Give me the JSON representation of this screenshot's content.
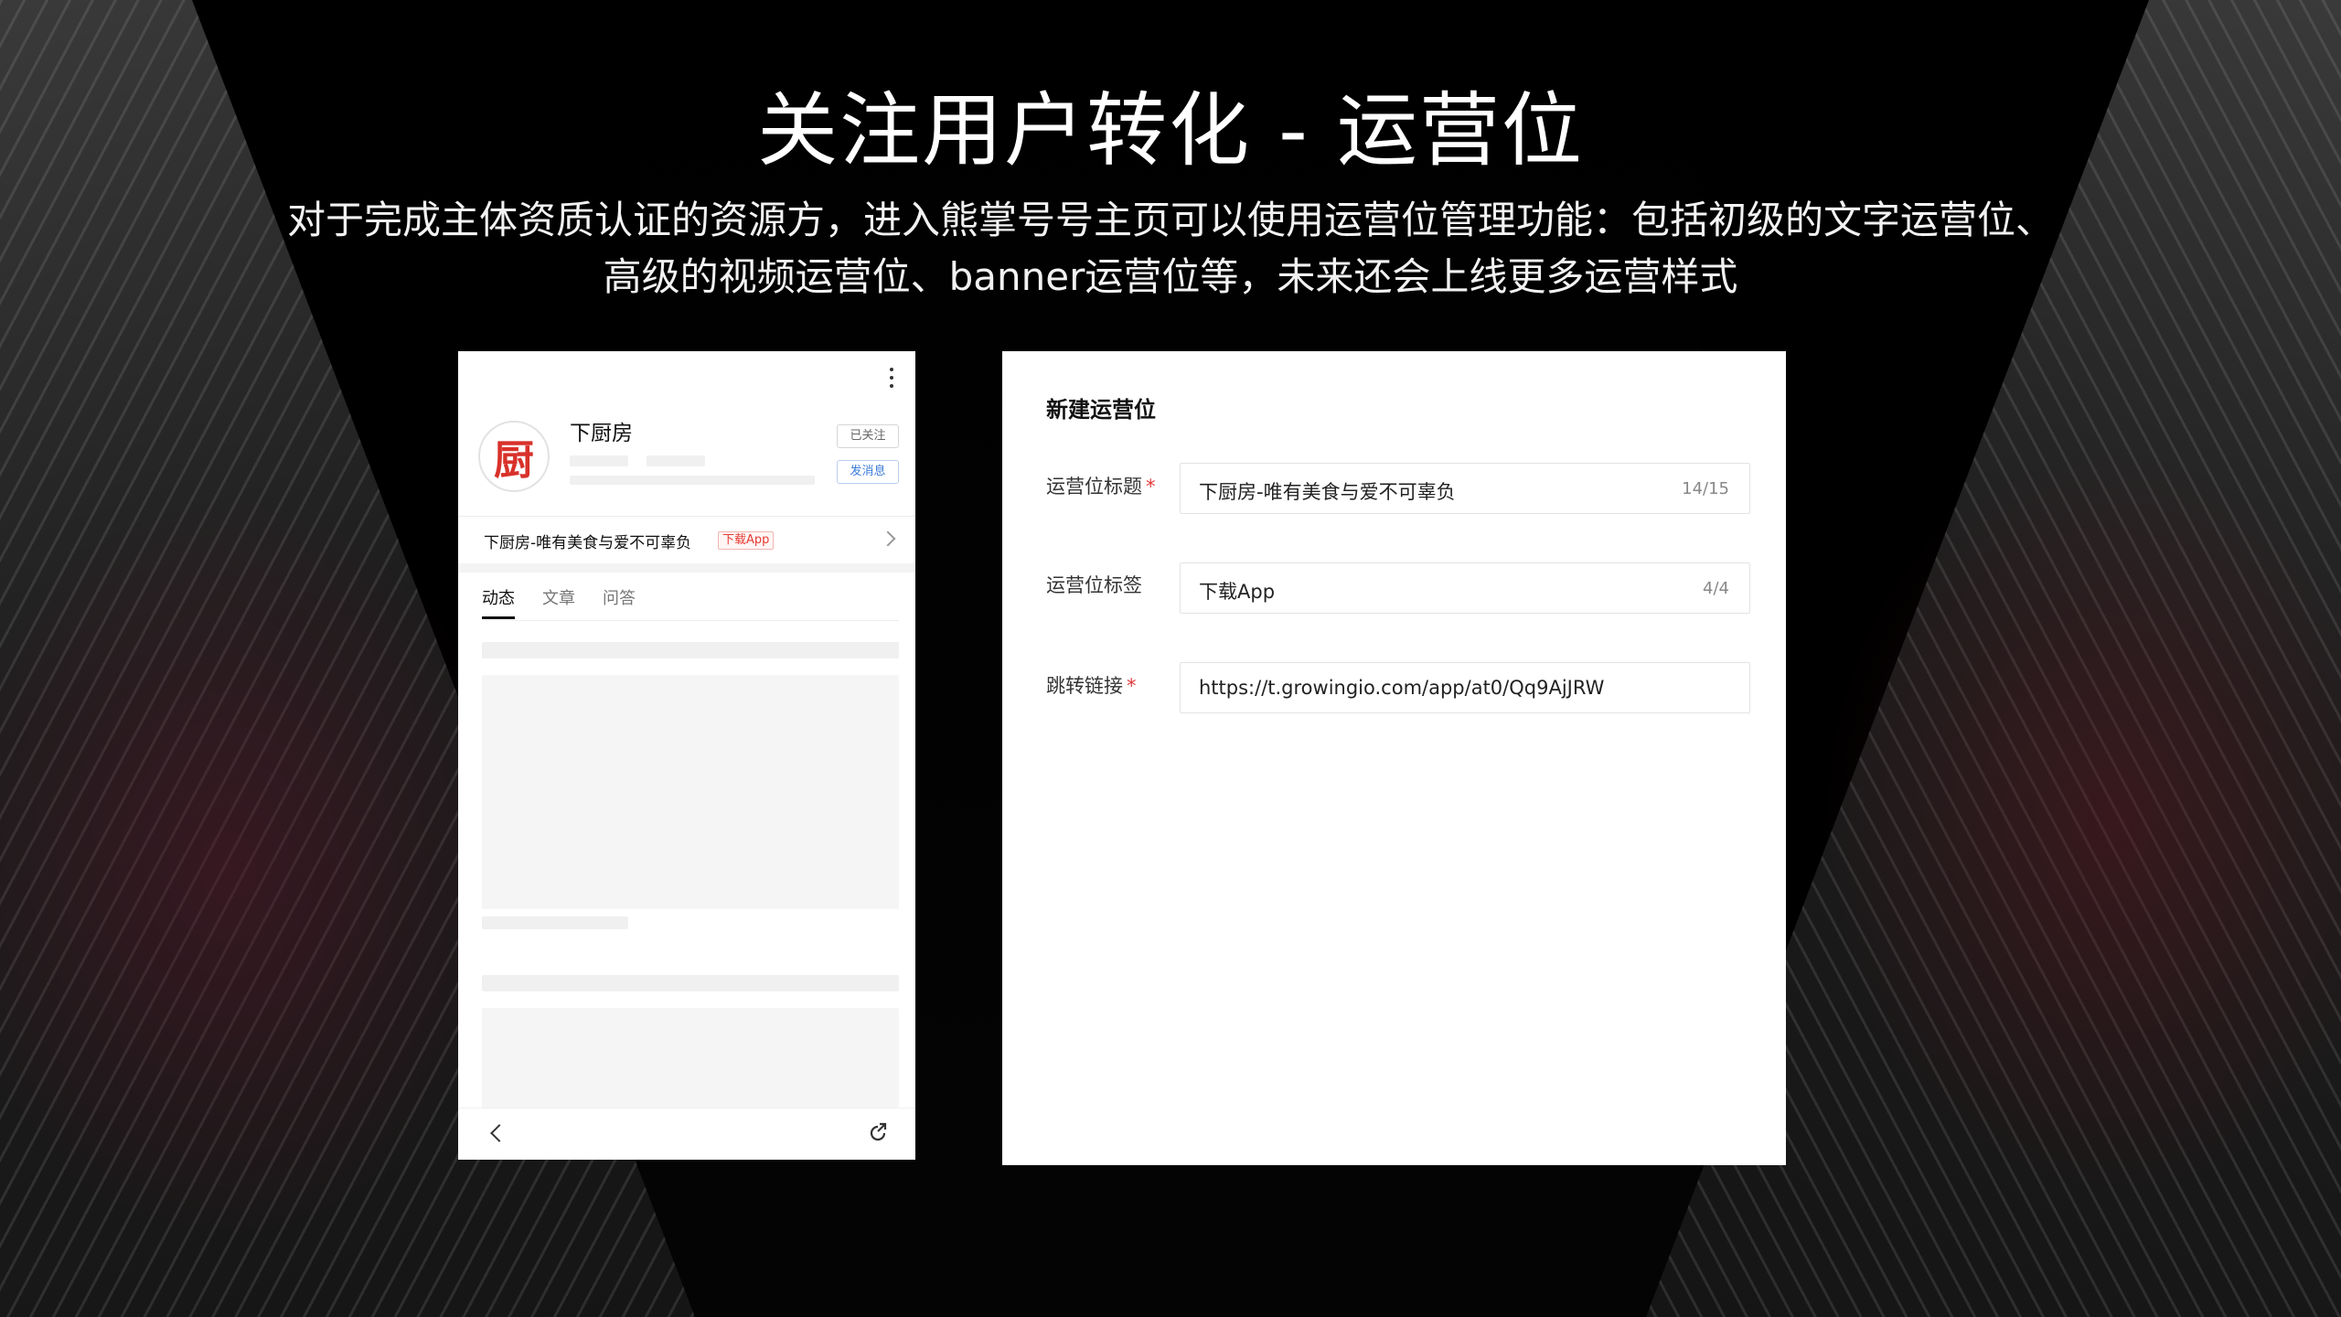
{
  "slide": {
    "title": "关注用户转化 - 运营位",
    "subtitle_line1": "对于完成主体资质认证的资源方，进入熊掌号号主页可以使用运营位管理功能：包括初级的文字运营位、",
    "subtitle_line2": "高级的视频运营位、banner运营位等，未来还会上线更多运营样式"
  },
  "phone": {
    "more_icon": "more-vertical-icon",
    "avatar_logo_text": "厨",
    "account_name": "下厨房",
    "followed_label": "已关注",
    "message_label": "发消息",
    "promo_text": "下厨房-唯有美食与爱不可辜负",
    "promo_tag": "下载App",
    "tabs": [
      "动态",
      "文章",
      "问答"
    ],
    "back_icon": "chevron-left-icon",
    "share_icon": "share-icon"
  },
  "form": {
    "title": "新建运营位",
    "fields": [
      {
        "label": "运营位标题",
        "required": "*",
        "value": "下厨房-唯有美食与爱不可辜负",
        "counter": "14/15"
      },
      {
        "label": "运营位标签",
        "required": "",
        "value": "下载App",
        "counter": "4/4"
      },
      {
        "label": "跳转链接",
        "required": "*",
        "value": "https://t.growingio.com/app/at0/Qq9AjJRW",
        "counter": ""
      }
    ]
  },
  "colors": {
    "accent_red": "#e23b3b",
    "link_blue": "#3b7bd9",
    "logo_red": "#d8312a"
  }
}
